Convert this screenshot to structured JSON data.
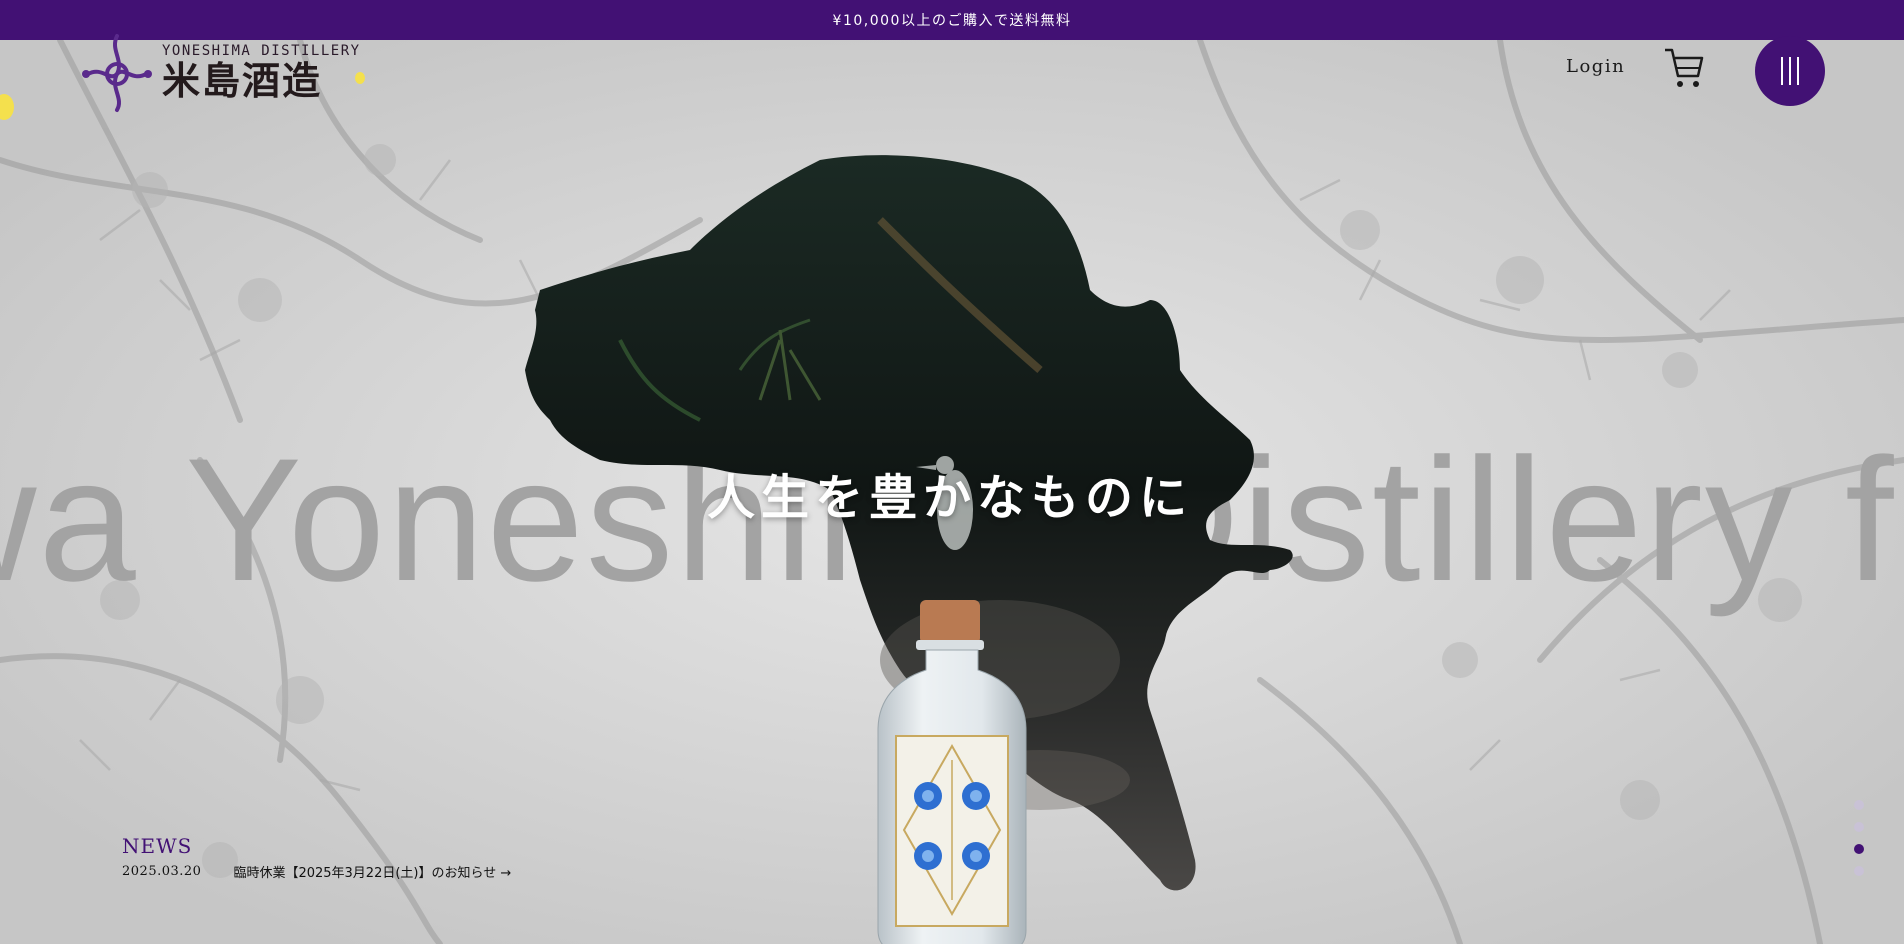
{
  "announcement": {
    "text": "¥10,000以上のご購入で送料無料"
  },
  "header": {
    "logo_en": "YONESHIMA DISTILLERY",
    "logo_jp": "米島酒造",
    "login_label": "Login",
    "cart_icon": "cart-icon",
    "menu_icon": "menu-icon"
  },
  "hero": {
    "headline": "人生を豊かなものに",
    "marquee": "wa    Yoneshima Distillery f"
  },
  "news": {
    "title": "NEWS",
    "items": [
      {
        "date": "2025.03.20",
        "text": "臨時休業【2025年3月22日(土)】のお知らせ →"
      }
    ]
  },
  "slider": {
    "total_dots": 4,
    "active_index": 3
  },
  "colors": {
    "brand_purple": "#421174",
    "background_gray": "#d4d4d4"
  }
}
